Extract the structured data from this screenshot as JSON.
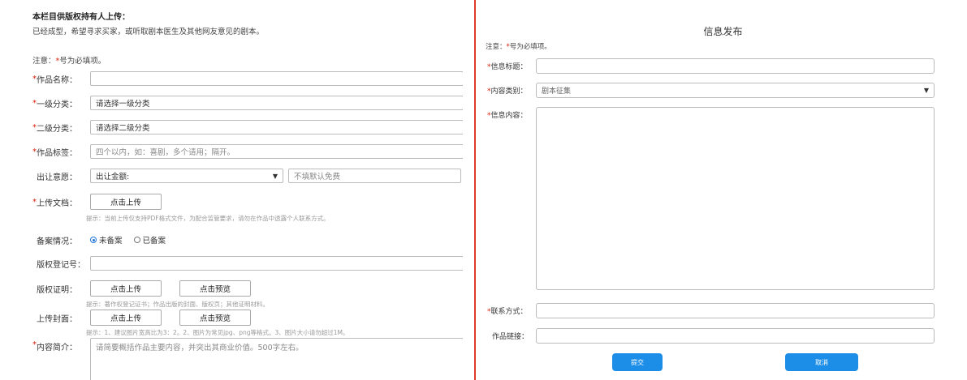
{
  "left": {
    "intro_title": "本栏目供版权持有人上传：",
    "intro_text": "已经成型，希望寻求买家，或听取剧本医生及其他网友意见的剧本。",
    "note_prefix": "注意：",
    "note_star": "*",
    "note_suffix": "号为必填项。",
    "fields": {
      "work_name": {
        "label": "作品名称：",
        "value": ""
      },
      "category1": {
        "label": "一级分类：",
        "value": "请选择一级分类"
      },
      "category2": {
        "label": "二级分类：",
        "value": "请选择二级分类"
      },
      "tags": {
        "label": "作品标签：",
        "placeholder": "四个以内，如：喜剧，多个请用；隔开。"
      },
      "transfer": {
        "label": "出让意愿：",
        "value": "出让金额:",
        "amount_placeholder": "不填默认免费"
      },
      "upload_doc": {
        "label": "上传文档：",
        "button": "点击上传",
        "hint": "提示：当前上传仅支持PDF格式文件，为配合监管要求，请勿在作品中透露个人联系方式。"
      },
      "record": {
        "label": "备案情况：",
        "options": [
          "未备案",
          "已备案"
        ],
        "selected": "未备案"
      },
      "copyright_reg": {
        "label": "版权登记号：",
        "value": ""
      },
      "copyright_proof": {
        "label": "版权证明：",
        "upload": "点击上传",
        "preview": "点击预览",
        "hint": "提示：著作权登记证书；作品出版的封面、版权页；其他证明材料。"
      },
      "cover": {
        "label": "上传封面：",
        "upload": "点击上传",
        "preview": "点击预览",
        "hint": "提示：1、建议图片宽高比为3：2。2、图片为常见jpg、png等格式。3、图片大小请勿超过1M。"
      },
      "summary": {
        "label": "内容简介：",
        "placeholder": "请简要概括作品主要内容，并突出其商业价值。500字左右。"
      }
    }
  },
  "right": {
    "title": "信息发布",
    "note_prefix": "注意：",
    "note_star": "*",
    "note_suffix": "号为必填项。",
    "fields": {
      "info_title": {
        "label": "信息标题：",
        "value": ""
      },
      "content_type": {
        "label": "内容类别：",
        "value": "剧本征集"
      },
      "info_content": {
        "label": "信息内容：",
        "value": ""
      },
      "contact": {
        "label": "联系方式：",
        "value": ""
      },
      "link": {
        "label": "作品链接：",
        "value": ""
      }
    },
    "submit": "提交",
    "cancel": "取消"
  },
  "colors": {
    "required_star": "#d81e06",
    "divider": "#e0392b",
    "button_blue": "#1c8ee8",
    "radio_selected": "#1e74d9"
  }
}
